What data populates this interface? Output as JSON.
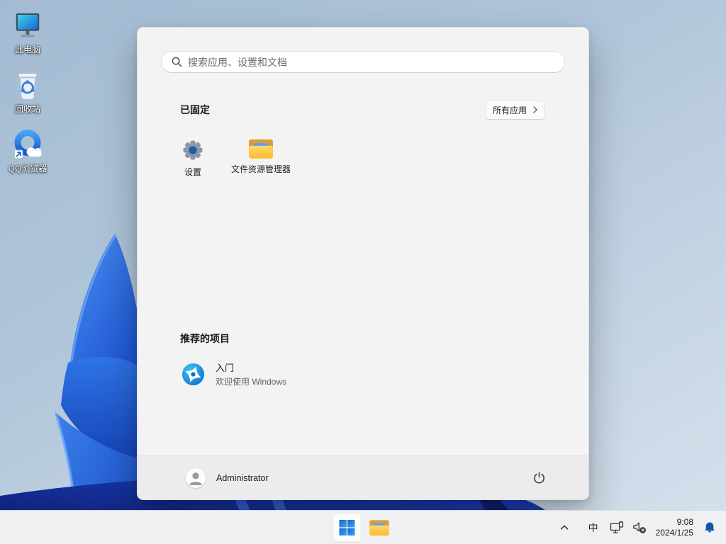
{
  "desktop": {
    "icons": [
      {
        "name": "this-pc",
        "label": "此电脑"
      },
      {
        "name": "recycle-bin",
        "label": "回收站"
      },
      {
        "name": "qq-browser",
        "label": "QQ浏览器"
      }
    ]
  },
  "start_menu": {
    "search_placeholder": "搜索应用、设置和文档",
    "pinned_section": {
      "title": "已固定",
      "all_apps_label": "所有应用"
    },
    "pinned_apps": [
      {
        "name": "settings",
        "label": "设置"
      },
      {
        "name": "file-explorer",
        "label": "文件资源管理器"
      }
    ],
    "recommended_section": {
      "title": "推荐的项目"
    },
    "recommended_items": [
      {
        "name": "get-started",
        "title": "入门",
        "subtitle": "欢迎使用 Windows"
      }
    ],
    "user": {
      "name": "Administrator"
    }
  },
  "taskbar": {
    "input_indicator": "中",
    "clock": {
      "time": "9:08",
      "date": "2024/1/25"
    }
  },
  "icons": {
    "search": "magnifier-icon",
    "all_apps_chevron": "chevron-right-icon",
    "power": "power-icon",
    "tray": [
      "chevron-up-icon",
      "ime-indicator",
      "ethernet-icon",
      "volume-muted-icon",
      "notification-bell-icon"
    ]
  },
  "colors": {
    "accent_blue": "#1b74d9",
    "bell_blue": "#0d57a9",
    "menu_bg": "#f3f3f3",
    "taskbar_bg": "#eef0f2",
    "bloom_blue": "#2a6fe0"
  }
}
